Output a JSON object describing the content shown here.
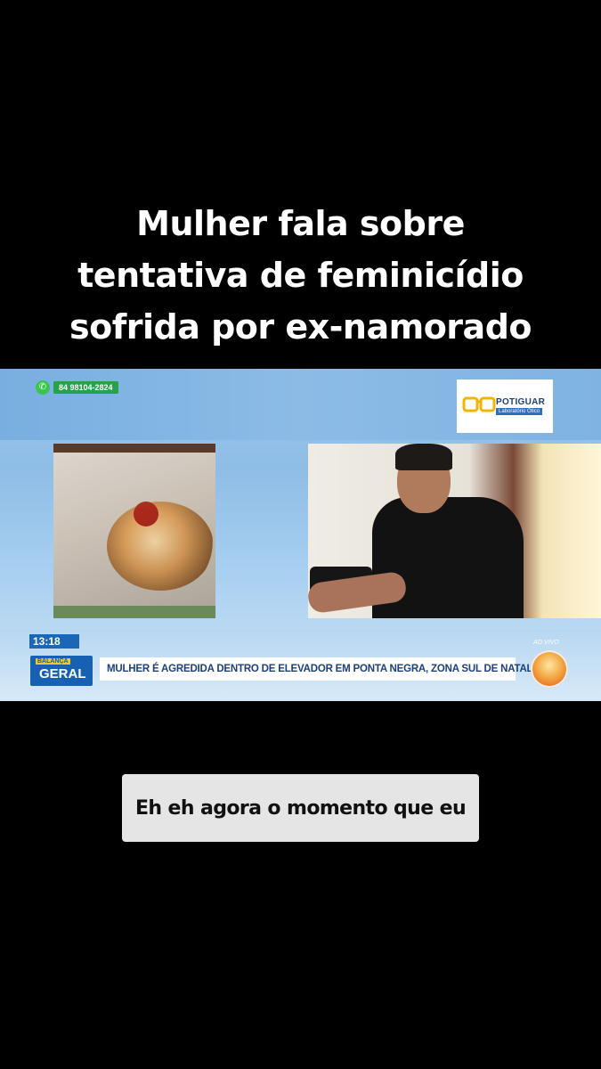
{
  "headline": {
    "lines": [
      "Mulher fala sobre",
      "tentativa de feminicídio",
      "sofrida por ex-namorado"
    ]
  },
  "broadcast": {
    "phone_number": "84 98104-2824",
    "sponsor": {
      "name": "POTIGUAR",
      "tagline": "Laboratório Ótico"
    },
    "time": "13:18",
    "show_logo": {
      "top": "BALANÇA",
      "bottom": "GERAL"
    },
    "news_ticker": "MULHER É AGREDIDA DENTRO DE ELEVADOR EM PONTA NEGRA, ZONA SUL DE NATAL",
    "live_label": "AO VIVO",
    "channel_logo_icon": "sun-channel-logo-icon",
    "colors": {
      "ticker_blue": "#1a66b7",
      "ticker_text": "#1d3f7a",
      "whatsapp_green": "#25a24a"
    }
  },
  "caption": {
    "text": "Eh eh agora o momento que eu"
  }
}
